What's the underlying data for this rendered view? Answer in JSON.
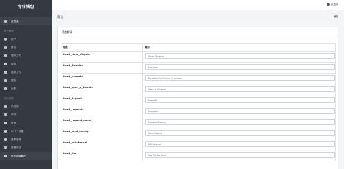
{
  "app": {
    "title": "专业钱包"
  },
  "sidebar": {
    "items": [
      {
        "label": "仪表盘",
        "icon": "dashboard-icon"
      }
    ],
    "section1": {
      "header": "用户管理"
    },
    "section1_items": [
      {
        "label": "用户",
        "icon": "users-icon"
      },
      {
        "label": "钱包",
        "icon": "wallet-icon"
      },
      {
        "label": "提款方式",
        "icon": "withdraw-method-icon"
      },
      {
        "label": "存款",
        "icon": "deposit-icon"
      },
      {
        "label": "提款方式",
        "icon": "withdraw-icon"
      },
      {
        "label": "提款",
        "icon": "withdrawal-icon"
      },
      {
        "label": "出售",
        "icon": "sale-icon"
      }
    ],
    "section2": {
      "header": "系统设置"
    },
    "section2_items": [
      {
        "label": "系统集",
        "icon": "system-icon"
      },
      {
        "label": "币种",
        "icon": "currency-icon"
      },
      {
        "label": "费用",
        "icon": "fee-icon"
      },
      {
        "label": "SMTP 设置",
        "icon": "smtp-icon"
      },
      {
        "label": "费率编辑",
        "icon": "rate-icon"
      },
      {
        "label": "管理网站",
        "icon": "site-icon"
      },
      {
        "label": "语言翻译管理",
        "icon": "language-icon"
      }
    ]
  },
  "topbar": {
    "user_label": "已登录"
  },
  "page": {
    "title": "语言",
    "save_label": "保存"
  },
  "card": {
    "header": "语言翻译"
  },
  "table": {
    "headers": [
      "钥匙",
      "翻译"
    ],
    "rows": [
      {
        "key": "head_close_dispute",
        "value": "Close Dispute"
      },
      {
        "key": "head_disputes",
        "value": "Disputes"
      },
      {
        "key": "head_escalate",
        "value": "Escalate for Yelerarch review"
      },
      {
        "key": "head_open_a_dispute",
        "value": "Open a Dispute"
      },
      {
        "key": "head_deposit",
        "value": "Deposit"
      },
      {
        "key": "head_requests",
        "value": "Requests"
      },
      {
        "key": "head_request_money",
        "value": "Request Money"
      },
      {
        "key": "head_send_money",
        "value": "Send Money"
      },
      {
        "key": "head_withdrawal",
        "value": "Withdrawal"
      },
      {
        "key": "head_2fa",
        "value": "Two Factor Auth"
      }
    ]
  }
}
